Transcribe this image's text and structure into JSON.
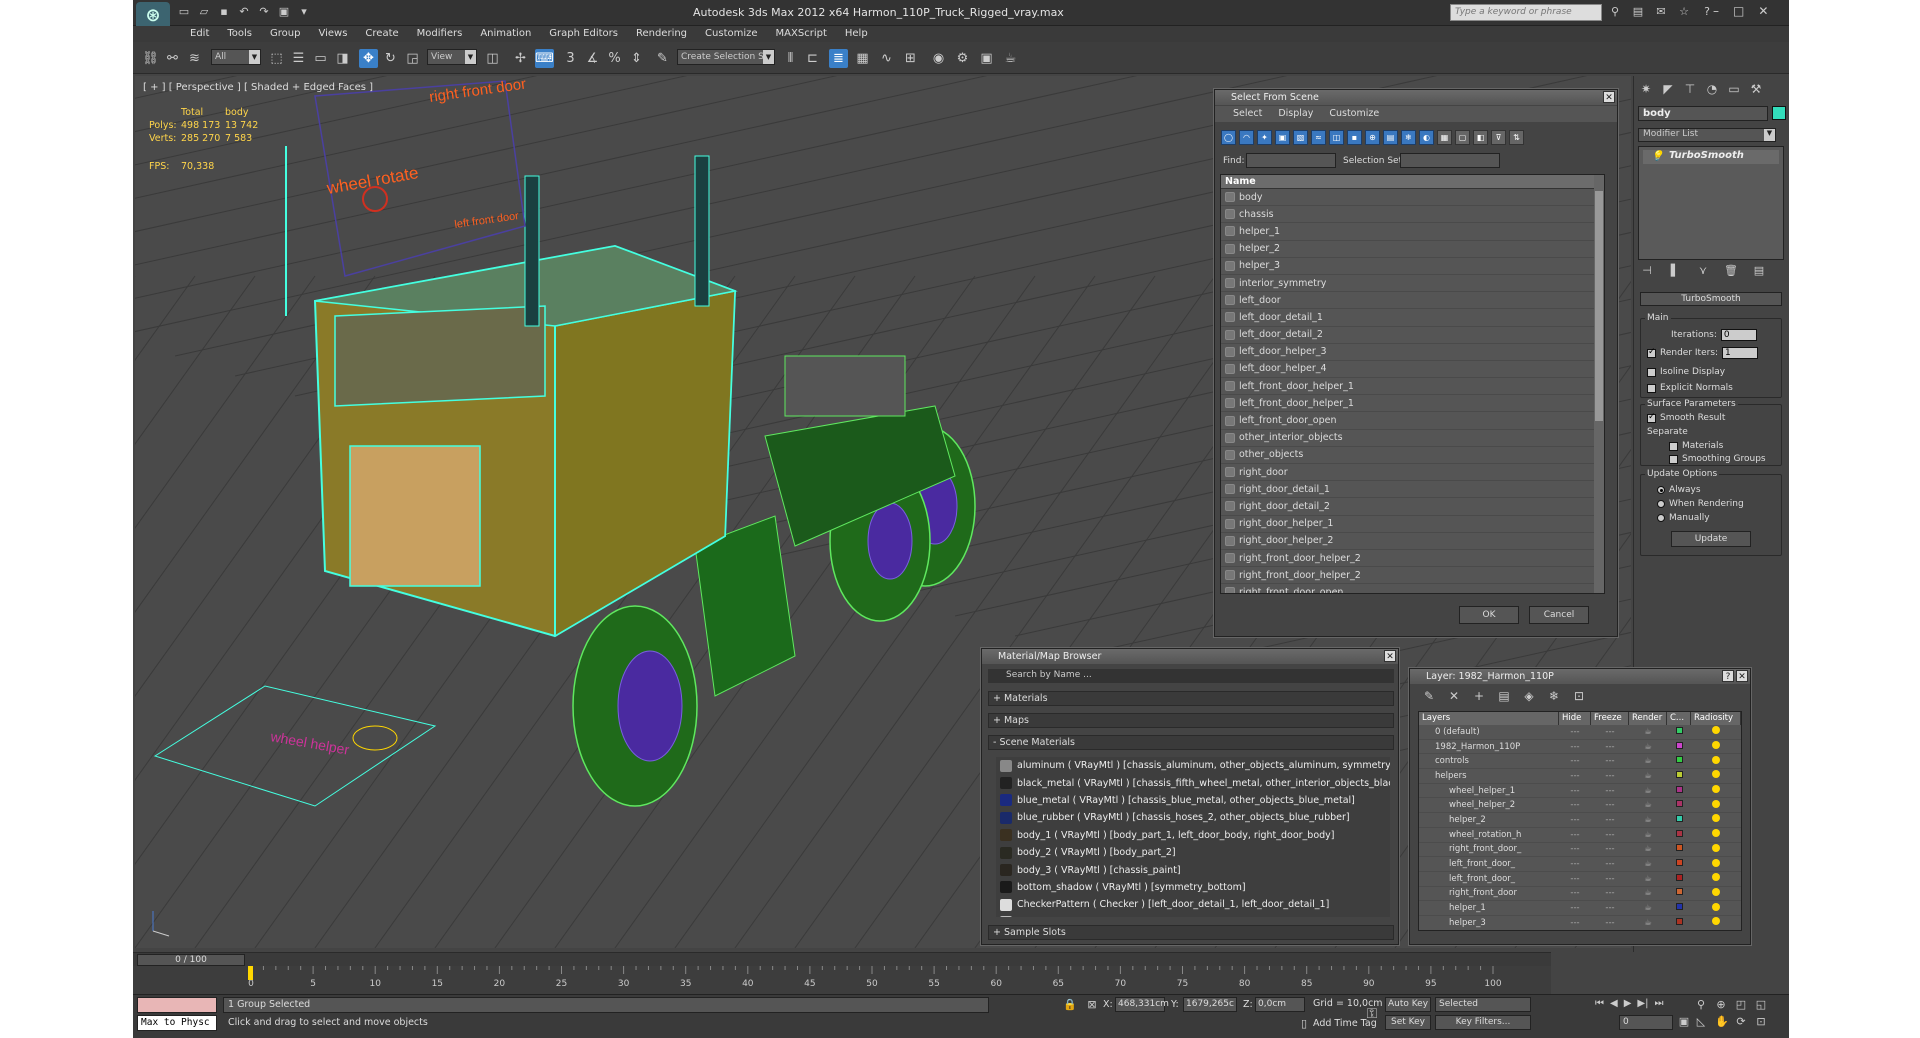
{
  "window": {
    "title": "Autodesk 3ds Max  2012 x64     Harmon_110P_Truck_Rigged_vray.max",
    "search_placeholder": "Type a keyword or phrase"
  },
  "menu": [
    "Edit",
    "Tools",
    "Group",
    "Views",
    "Create",
    "Modifiers",
    "Animation",
    "Graph Editors",
    "Rendering",
    "Customize",
    "MAXScript",
    "Help"
  ],
  "toolbar": {
    "filter_value": "All",
    "refcoord_value": "View",
    "selection_set": "Create Selection Se"
  },
  "viewport": {
    "label": "[ + ] [ Perspective ] [ Shaded + Edged Faces ]",
    "stats": {
      "col_total": "Total",
      "col_selected": "body",
      "polys_label": "Polys:",
      "polys_total": "498 173",
      "polys_sel": "13 742",
      "verts_label": "Verts:",
      "verts_total": "285 270",
      "verts_sel": "7 583",
      "fps_label": "FPS:",
      "fps_value": "70,338"
    },
    "scene_labels": {
      "right_front_door": "right front door",
      "wheel_rotate": "wheel rotate",
      "left_front_door": "left front door",
      "wheel_helper": "wheel helper"
    }
  },
  "command_panel": {
    "object_name": "body",
    "object_color": "#33ddbb",
    "modifier_list": "Modifier List",
    "stack_item": "TurboSmooth",
    "rollout_title": "TurboSmooth",
    "main_group": "Main",
    "iterations_label": "Iterations:",
    "iterations_value": "0",
    "render_iters_label": "Render Iters:",
    "render_iters_value": "1",
    "isoline": "Isoline Display",
    "explicit_normals": "Explicit Normals",
    "surface_group": "Surface Parameters",
    "smooth_result": "Smooth Result",
    "separate": "Separate",
    "materials": "Materials",
    "smoothing_groups": "Smoothing Groups",
    "update_group": "Update Options",
    "always": "Always",
    "when_rendering": "When Rendering",
    "manually": "Manually",
    "update_button": "Update"
  },
  "select_from_scene": {
    "title": "Select From Scene",
    "menu": [
      "Select",
      "Display",
      "Customize"
    ],
    "find_label": "Find:",
    "selection_set_label": "Selection Set:",
    "column_name": "Name",
    "objects": [
      "body",
      "chassis",
      "helper_1",
      "helper_2",
      "helper_3",
      "interior_symmetry",
      "left_door",
      "left_door_detail_1",
      "left_door_detail_2",
      "left_door_helper_3",
      "left_door_helper_4",
      "left_front_door_helper_1",
      "left_front_door_helper_1",
      "left_front_door_open",
      "other_interior_objects",
      "other_objects",
      "right_door",
      "right_door_detail_1",
      "right_door_detail_2",
      "right_door_helper_1",
      "right_door_helper_2",
      "right_front_door_helper_2",
      "right_front_door_helper_2",
      "right_front_door_open"
    ],
    "ok": "OK",
    "cancel": "Cancel"
  },
  "material_browser": {
    "title": "Material/Map Browser",
    "search": "Search by Name ...",
    "sec_materials": "+ Materials",
    "sec_maps": "+ Maps",
    "sec_scene": "- Scene Materials",
    "sec_sample": "+ Sample Slots",
    "items": [
      {
        "text": "aluminum  ( VRayMtl ) [chassis_aluminum, other_objects_aluminum, symmetry_",
        "color": "#888888"
      },
      {
        "text": "black_metal  ( VRayMtl ) [chassis_fifth_wheel_metal, other_interior_objects_blac",
        "color": "#222222"
      },
      {
        "text": "blue_metal  ( VRayMtl ) [chassis_blue_metal, other_objects_blue_metal]",
        "color": "#1a2a80"
      },
      {
        "text": "blue_rubber  ( VRayMtl ) [chassis_hoses_2, other_objects_blue_rubber]",
        "color": "#1a2a6a"
      },
      {
        "text": "body_1  ( VRayMtl ) [body_part_1, left_door_body, right_door_body]",
        "color": "#3a3020"
      },
      {
        "text": "body_2  ( VRayMtl ) [body_part_2]",
        "color": "#2a2a22"
      },
      {
        "text": "body_3  ( VRayMtl ) [chassis_paint]",
        "color": "#2a2620"
      },
      {
        "text": "bottom_shadow  ( VRayMtl ) [symmetry_bottom]",
        "color": "#1a1a1a"
      },
      {
        "text": "CheckerPattern  ( Checker ) [left_door_detail_1, left_door_detail_1]",
        "color": "#dddddd"
      },
      {
        "text": "Chrome  ( VRayMtl ) [chassis_chrome, left_door_chrome, other_objects_chrome]",
        "color": "#bbbbbb"
      }
    ]
  },
  "layer_manager": {
    "title": "Layer: 1982_Harmon_110P",
    "columns": [
      "Layers",
      "Hide",
      "Freeze",
      "Render",
      "C...",
      "Radiosity"
    ],
    "rows": [
      {
        "name": "0 (default)",
        "color": "#33cc66",
        "indent": 0
      },
      {
        "name": "1982_Harmon_110P",
        "color": "#cc44cc",
        "indent": 0
      },
      {
        "name": "controls",
        "color": "#33cc44",
        "indent": 0
      },
      {
        "name": "helpers",
        "color": "#bbcc33",
        "indent": 0
      },
      {
        "name": "wheel_helper_1",
        "color": "#aa3388",
        "indent": 1
      },
      {
        "name": "wheel_helper_2",
        "color": "#aa3366",
        "indent": 1
      },
      {
        "name": "helper_2",
        "color": "#33ccaa",
        "indent": 1
      },
      {
        "name": "wheel_rotation_h",
        "color": "#aa3344",
        "indent": 1
      },
      {
        "name": "right_front_door_",
        "color": "#cc5522",
        "indent": 1
      },
      {
        "name": "left_front_door_",
        "color": "#cc4422",
        "indent": 1
      },
      {
        "name": "left_front_door_",
        "color": "#aa2222",
        "indent": 1
      },
      {
        "name": "right_front_door",
        "color": "#cc6633",
        "indent": 1
      },
      {
        "name": "helper_1",
        "color": "#2233aa",
        "indent": 1
      },
      {
        "name": "helper_3",
        "color": "#aa3322",
        "indent": 1
      }
    ]
  },
  "timeline": {
    "slider": "0 / 100",
    "ticks": [
      0,
      5,
      10,
      15,
      20,
      25,
      30,
      35,
      40,
      45,
      50,
      55,
      60,
      65,
      70,
      75,
      80,
      85,
      90,
      95,
      100
    ]
  },
  "status": {
    "maxscript": "Max to Physc",
    "selected": "1 Group Selected",
    "prompt": "Click and drag to select and move objects",
    "x_label": "X:",
    "x_value": "468,331cm",
    "y_label": "Y:",
    "y_value": "1679,265c",
    "z_label": "Z:",
    "z_value": "0,0cm",
    "grid": "Grid = 10,0cm",
    "add_time_tag": "Add Time Tag",
    "auto_key": "Auto Key",
    "set_key": "Set Key",
    "key_mode": "Selected",
    "key_filters": "Key Filters...",
    "frame": "0"
  }
}
